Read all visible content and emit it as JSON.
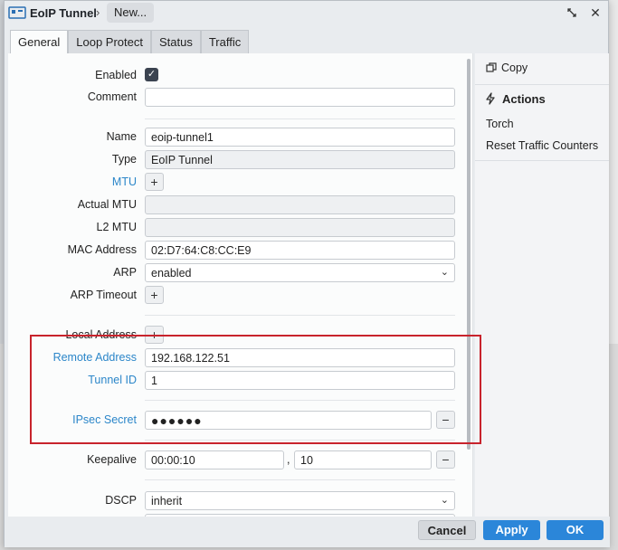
{
  "titlebar": {
    "title": "EoIP Tunnel",
    "separator": "›",
    "crumb": "New..."
  },
  "tabs": [
    "General",
    "Loop Protect",
    "Status",
    "Traffic"
  ],
  "form": {
    "enabled_label": "Enabled",
    "comment_label": "Comment",
    "comment_value": "",
    "name_label": "Name",
    "name_value": "eoip-tunnel1",
    "type_label": "Type",
    "type_value": "EoIP Tunnel",
    "mtu_label": "MTU",
    "actual_mtu_label": "Actual MTU",
    "l2_mtu_label": "L2 MTU",
    "mac_label": "MAC Address",
    "mac_value": "02:D7:64:C8:CC:E9",
    "arp_label": "ARP",
    "arp_value": "enabled",
    "arp_timeout_label": "ARP Timeout",
    "local_address_label": "Local Address",
    "remote_address_label": "Remote Address",
    "remote_address_value": "192.168.122.51",
    "tunnel_id_label": "Tunnel ID",
    "tunnel_id_value": "1",
    "ipsec_label": "IPsec Secret",
    "ipsec_value": "●●●●●●",
    "keepalive_label": "Keepalive",
    "keepalive_value1": "00:00:10",
    "keepalive_sep": ",",
    "keepalive_value2": "10",
    "dscp_label": "DSCP",
    "dscp_value": "inherit",
    "plus": "+",
    "minus": "−"
  },
  "side": {
    "copy": "Copy",
    "actions_title": "Actions",
    "torch": "Torch",
    "reset": "Reset Traffic Counters"
  },
  "footer": {
    "cancel": "Cancel",
    "apply": "Apply",
    "ok": "OK"
  },
  "colors": {
    "link": "#2b86c9",
    "primary": "#2b86d9",
    "highlight": "#c8232c"
  }
}
